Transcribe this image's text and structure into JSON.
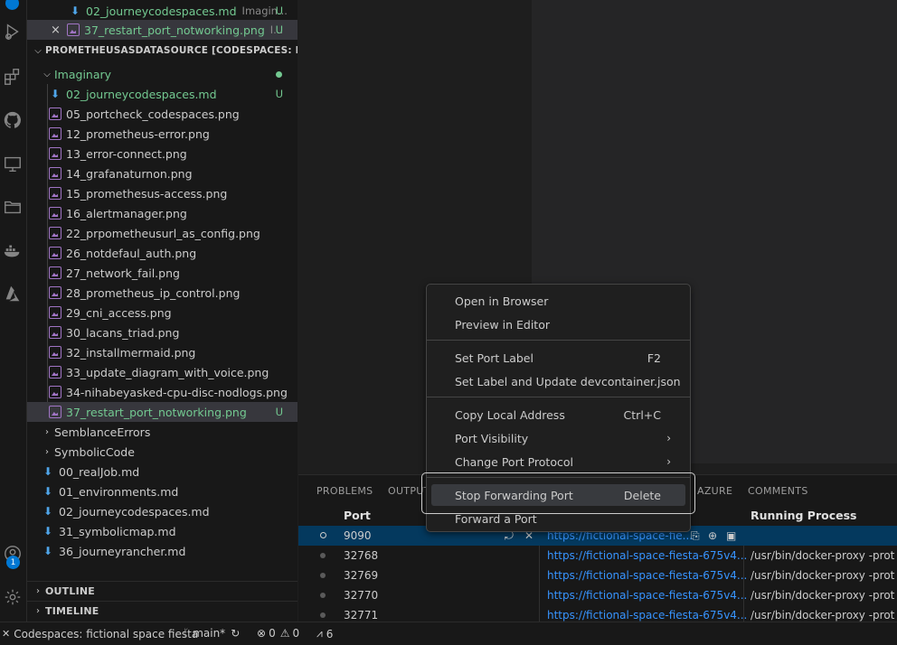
{
  "colors": {
    "accent": "#0078d4",
    "git_added": "#73c991",
    "link": "#3794ff",
    "png_icon": "#a074c4",
    "md_icon": "#4fa6ea"
  },
  "activity_bar": {
    "icons": [
      "run-debug-icon",
      "extensions-icon",
      "github-icon",
      "remote-explorer-icon",
      "folders-icon",
      "docker-icon",
      "azure-icon",
      "accounts-icon",
      "settings-icon"
    ],
    "accounts_badge": "1"
  },
  "explorer": {
    "open_editors": [
      {
        "name": "02_journeycodespaces.md",
        "desc": "Imagin...",
        "status": "U"
      },
      {
        "name": "37_restart_port_notworking.png",
        "desc": "I...",
        "status": "U",
        "close": "×"
      }
    ],
    "workspace_header": "PROMETHEUSASDATASOURCE [CODESPACES: FICTI...",
    "folder_imaginary": {
      "name": "Imaginary"
    },
    "imaginary_files": [
      {
        "name": "02_journeycodespaces.md",
        "status": "U"
      },
      {
        "name": "05_portcheck_codespaces.png"
      },
      {
        "name": "12_prometheus-error.png"
      },
      {
        "name": "13_error-connect.png"
      },
      {
        "name": "14_grafanaturnon.png"
      },
      {
        "name": "15_promethesus-access.png"
      },
      {
        "name": "16_alertmanager.png"
      },
      {
        "name": "22_prpometheusurl_as_config.png"
      },
      {
        "name": "26_notdefaul_auth.png"
      },
      {
        "name": "27_network_fail.png"
      },
      {
        "name": "28_prometheus_ip_control.png"
      },
      {
        "name": "29_cni_access.png"
      },
      {
        "name": "30_lacans_triad.png"
      },
      {
        "name": "32_installmermaid.png"
      },
      {
        "name": "33_update_diagram_with_voice.png"
      },
      {
        "name": "34-nihabeyasked-cpu-disc-nodlogs.png"
      },
      {
        "name": "37_restart_port_notworking.png",
        "status": "U"
      }
    ],
    "folders": [
      "SemblanceErrors",
      "SymbolicCode"
    ],
    "root_files": [
      "00_realJob.md",
      "01_environments.md",
      "02_journeycodespaces.md",
      "31_symbolicmap.md",
      "36_journeyrancher.md"
    ],
    "outline": "OUTLINE",
    "timeline": "TIMELINE"
  },
  "panel": {
    "tabs": [
      "PROBLEMS",
      "OUTPUT",
      "AZURE",
      "COMMENTS"
    ],
    "columns": {
      "port": "Port",
      "process": "Running Process"
    },
    "rows": [
      {
        "port": "9090",
        "address": "https://fictional-space-fie...",
        "process": ""
      },
      {
        "port": "32768",
        "address": "https://fictional-space-fiesta-675v4...",
        "process": "/usr/bin/docker-proxy -prot"
      },
      {
        "port": "32769",
        "address": "https://fictional-space-fiesta-675v4...",
        "process": "/usr/bin/docker-proxy -prot"
      },
      {
        "port": "32770",
        "address": "https://fictional-space-fiesta-675v4...",
        "process": "/usr/bin/docker-proxy -prot"
      },
      {
        "port": "32771",
        "address": "https://fictional-space-fiesta-675v4...",
        "process": "/usr/bin/docker-proxy -prot"
      }
    ]
  },
  "context_menu": {
    "open_in_browser": "Open in Browser",
    "preview_in_editor": "Preview in Editor",
    "set_port_label": "Set Port Label",
    "set_port_label_kb": "F2",
    "set_label_devcontainer": "Set Label and Update devcontainer.json",
    "copy_local_address": "Copy Local Address",
    "copy_local_address_kb": "Ctrl+C",
    "port_visibility": "Port Visibility",
    "change_port_protocol": "Change Port Protocol",
    "stop_forwarding_port": "Stop Forwarding Port",
    "stop_forwarding_port_kb": "Delete",
    "forward_a_port": "Forward a Port"
  },
  "status_bar": {
    "remote": "Codespaces: fictional space fiesta",
    "branch": "main*",
    "errors": "0",
    "warnings": "0",
    "ports": "6"
  }
}
